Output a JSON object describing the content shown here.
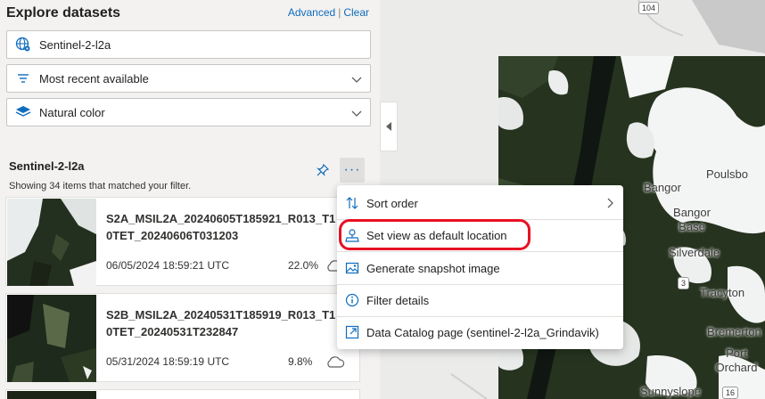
{
  "header": {
    "title": "Explore datasets",
    "advanced_label": "Advanced",
    "separator": "|",
    "clear_label": "Clear"
  },
  "filters": {
    "collection": "Sentinel-2-l2a",
    "sort": "Most recent available",
    "render": "Natural color"
  },
  "results": {
    "collection_title": "Sentinel-2-l2a",
    "summary": "Showing 34 items that matched your filter.",
    "more_label": "···",
    "items": [
      {
        "name": "S2A_MSIL2A_20240605T185921_R013_T10TET_20240606T031203",
        "date": "06/05/2024 18:59:21 UTC",
        "cloud": "22.0%"
      },
      {
        "name": "S2B_MSIL2A_20240531T185919_R013_T10TET_20240531T232847",
        "date": "05/31/2024 18:59:19 UTC",
        "cloud": "9.8%"
      }
    ]
  },
  "menu": {
    "items": [
      {
        "label": "Sort order",
        "icon": "sort-icon"
      },
      {
        "label": "Set view as default location",
        "icon": "location-icon"
      },
      {
        "label": "Generate snapshot image",
        "icon": "image-icon"
      },
      {
        "label": "Filter details",
        "icon": "info-icon"
      },
      {
        "label": "Data Catalog page (sentinel-2-l2a_Grindavik)",
        "icon": "open-link-icon"
      }
    ]
  },
  "map": {
    "labels": [
      "Poulsbo",
      "Bangor",
      "Bangor Base",
      "Silverdale",
      "Tracyton",
      "Bremerton",
      "Port Orchard",
      "Sunnyslope"
    ],
    "badges": [
      "3",
      "16",
      "104"
    ]
  },
  "colors": {
    "accent": "#0f6cbd",
    "highlight": "#e81123",
    "panel_bg": "#f3f2f1"
  }
}
